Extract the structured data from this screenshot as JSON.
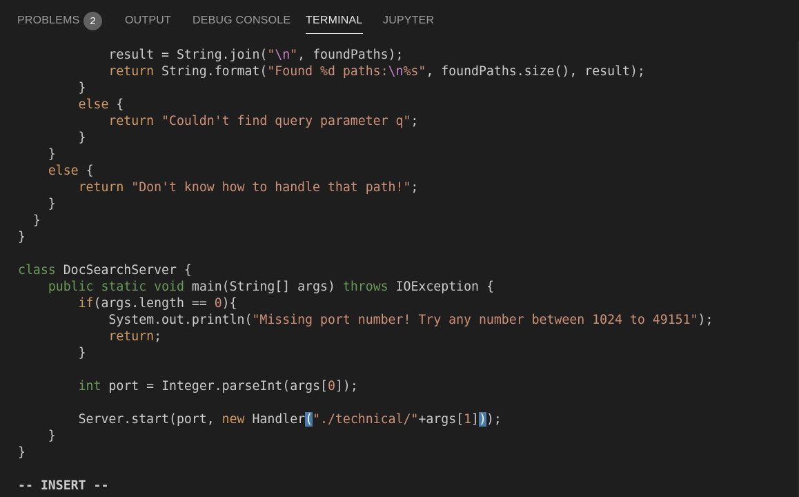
{
  "tabs": {
    "problems": "PROBLEMS",
    "problems_count": "2",
    "output": "OUTPUT",
    "debug_console": "DEBUG CONSOLE",
    "terminal": "TERMINAL",
    "jupyter": "JUPYTER"
  },
  "code": {
    "l01": {
      "ind": "            ",
      "a": "result = String.join(",
      "b": "\"",
      "c": "\\n",
      "d": "\"",
      "e": ", foundPaths);"
    },
    "l02": {
      "ind": "            ",
      "kw": "return",
      "a": " String.format(",
      "b": "\"Found %d paths:",
      "c": "\\n",
      "d": "%s\"",
      "e": ", foundPaths.size(), result);"
    },
    "l03": {
      "text": "        }"
    },
    "l04": {
      "ind": "        ",
      "kw": "else",
      "a": " {"
    },
    "l05": {
      "ind": "            ",
      "kw": "return",
      "a": " ",
      "s": "\"Couldn't find query parameter q\"",
      "e": ";"
    },
    "l06": {
      "text": "        }"
    },
    "l07": {
      "text": "    }"
    },
    "l08": {
      "ind": "    ",
      "kw": "else",
      "a": " {"
    },
    "l09": {
      "ind": "        ",
      "kw": "return",
      "a": " ",
      "s": "\"Don't know how to handle that path!\"",
      "e": ";"
    },
    "l10": {
      "text": "    }"
    },
    "l11": {
      "text": "  }"
    },
    "l12": {
      "text": "}"
    },
    "l13": {
      "text": ""
    },
    "l14": {
      "kw": "class",
      "a": " DocSearchServer {"
    },
    "l15": {
      "ind": "    ",
      "k1": "public",
      "sp1": " ",
      "k2": "static",
      "sp2": " ",
      "k3": "void",
      "a": " main(String[] args) ",
      "k4": "throws",
      "e": " IOException {"
    },
    "l16": {
      "ind": "        ",
      "kw": "if",
      "a": "(args.length == ",
      "n": "0",
      "e": "){"
    },
    "l17": {
      "ind": "            ",
      "a": "System.out.println(",
      "s": "\"Missing port number! Try any number between 1024 to 49151\"",
      "e": ");"
    },
    "l18": {
      "ind": "            ",
      "kw": "return",
      "e": ";"
    },
    "l19": {
      "text": "        }"
    },
    "l20": {
      "text": ""
    },
    "l21": {
      "ind": "        ",
      "kw": "int",
      "a": " port = Integer.parseInt(args[",
      "n": "0",
      "e": "]);"
    },
    "l22": {
      "text": ""
    },
    "l23": {
      "ind": "        ",
      "a": "Server.start(port, ",
      "kw": "new",
      "b": " Handler",
      "c1": "(",
      "s": "\"./technical/\"",
      "d": "+args[",
      "n": "1",
      "e1": "]",
      "c2": ")",
      "e": ");"
    },
    "l24": {
      "text": "    }"
    },
    "l25": {
      "text": "}"
    },
    "l26": {
      "text": ""
    },
    "l27": {
      "text": "-- INSERT --"
    }
  }
}
